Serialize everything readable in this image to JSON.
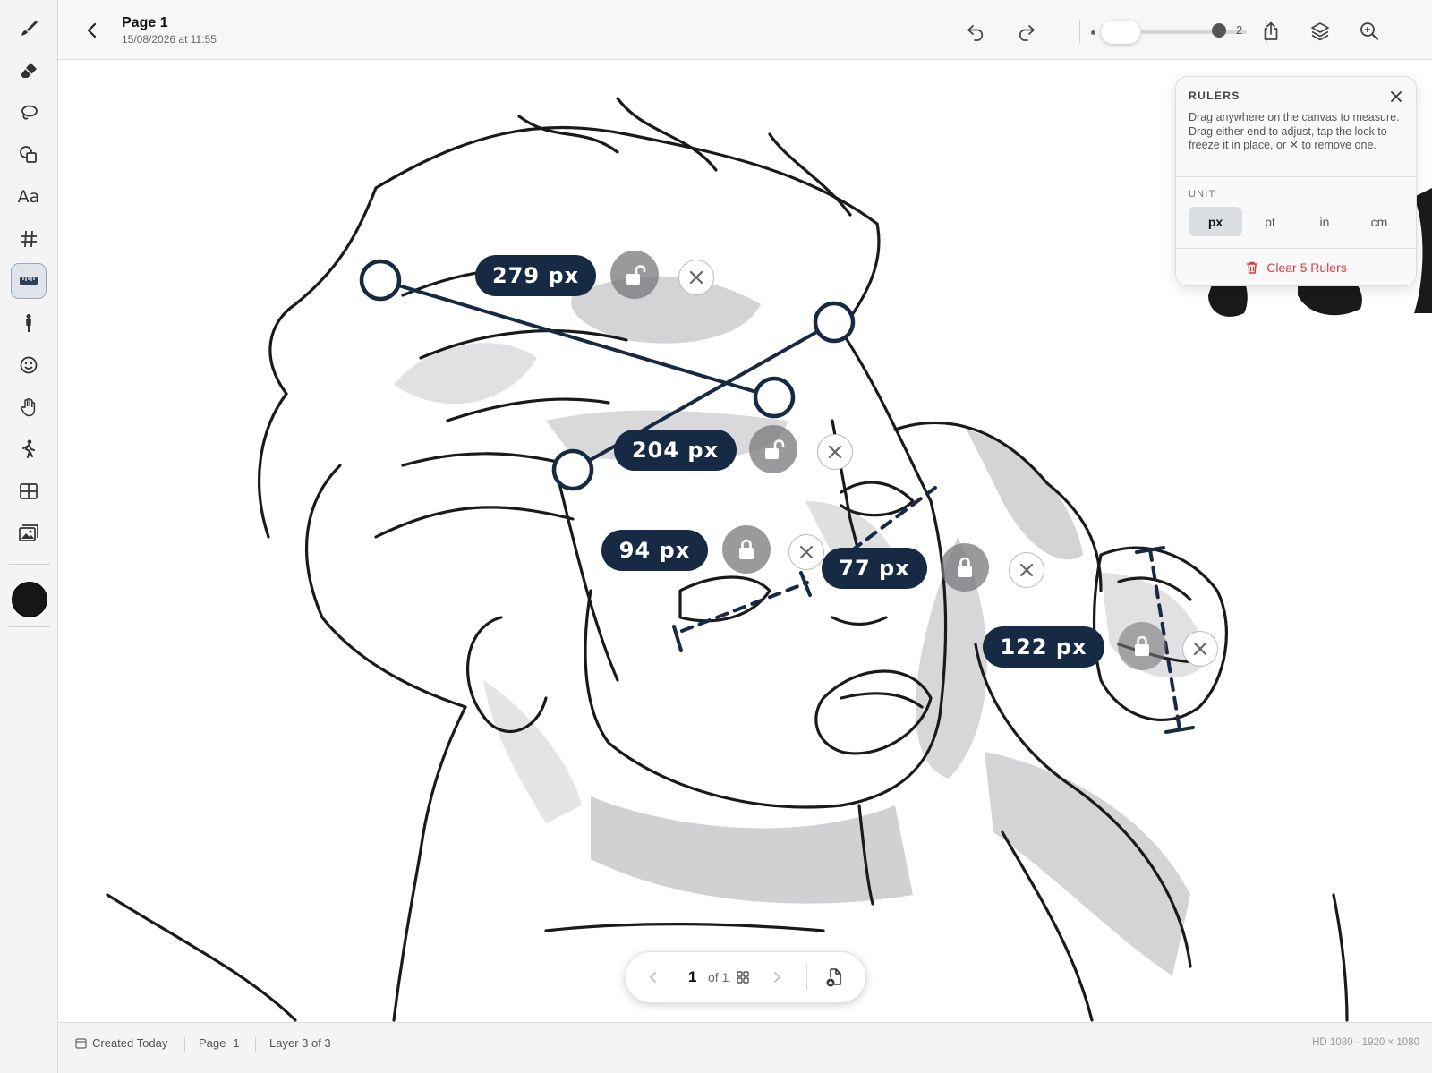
{
  "header": {
    "title": "Page 1",
    "date": "15/08/2026 at 11:55",
    "brush_size": "2"
  },
  "tools": [
    {
      "name": "brush-icon",
      "active": false
    },
    {
      "name": "eraser-icon",
      "active": false
    },
    {
      "name": "lasso-icon",
      "active": false
    },
    {
      "name": "shapes-icon",
      "active": false
    },
    {
      "name": "text-icon",
      "label": "Aa",
      "active": false
    },
    {
      "name": "grid-icon",
      "active": false
    },
    {
      "name": "ruler-icon",
      "active": true
    },
    {
      "name": "figure-icon",
      "active": false
    },
    {
      "name": "emoji-icon",
      "active": false
    },
    {
      "name": "hand-icon",
      "active": false
    },
    {
      "name": "pose-icon",
      "active": false
    },
    {
      "name": "panels-icon",
      "active": false
    },
    {
      "name": "image-icon",
      "active": false
    }
  ],
  "current_color": "#161616",
  "rulers": [
    {
      "label": "279 px",
      "locked": false
    },
    {
      "label": "204 px",
      "locked": false
    },
    {
      "label": "94 px",
      "locked": true
    },
    {
      "label": "77 px",
      "locked": true
    },
    {
      "label": "122 px",
      "locked": true
    }
  ],
  "rulers_panel": {
    "title": "RULERS",
    "description": "Drag anywhere on the canvas to measure. Drag either end to adjust, tap the lock to freeze it in place, or ✕ to remove one.",
    "unit_label": "UNIT",
    "units": [
      "px",
      "pt",
      "in",
      "cm"
    ],
    "selected_unit": "px",
    "clear_label": "Clear 5 Rulers"
  },
  "page_nav": {
    "current": "1",
    "of_label": "of 1"
  },
  "status": {
    "created": "Created Today",
    "page_label": "Page",
    "page_number": "1",
    "layer": "Layer 3 of 3",
    "resolution": "HD 1080 · 1920 × 1080"
  },
  "colors": {
    "ruler_accent": "#172a44",
    "danger": "#d83a3a"
  }
}
